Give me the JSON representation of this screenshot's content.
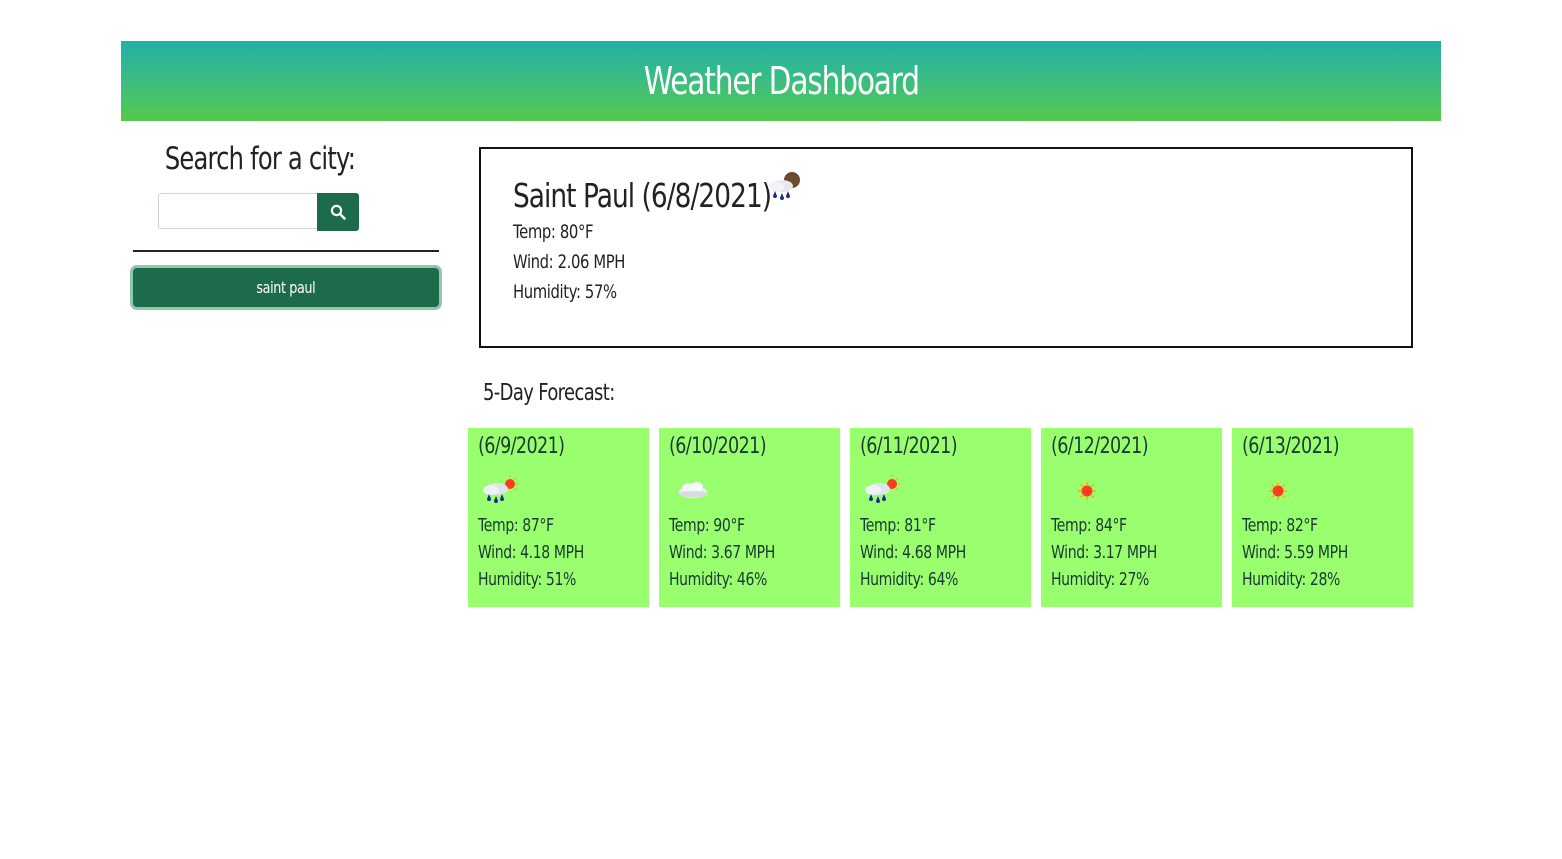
{
  "header": {
    "title": "Weather Dashboard"
  },
  "sidebar": {
    "search_heading": "Search for a city:",
    "search_input_value": "",
    "search_button_icon": "search-icon",
    "history": [
      {
        "label": "saint paul"
      }
    ]
  },
  "current": {
    "title": "Saint Paul (6/8/2021)",
    "icon": "rain-cloud-night-icon",
    "temp": "Temp: 80°F",
    "wind": "Wind: 2.06 MPH",
    "humidity": "Humidity: 57%"
  },
  "forecast": {
    "heading": "5-Day Forecast:",
    "days": [
      {
        "date": "(6/9/2021)",
        "icon": "rain-sun-icon",
        "temp": "Temp: 87°F",
        "wind": "Wind: 4.18 MPH",
        "humidity": "Humidity: 51%"
      },
      {
        "date": "(6/10/2021)",
        "icon": "cloud-icon",
        "temp": "Temp: 90°F",
        "wind": "Wind: 3.67 MPH",
        "humidity": "Humidity: 46%"
      },
      {
        "date": "(6/11/2021)",
        "icon": "rain-sun-icon",
        "temp": "Temp: 81°F",
        "wind": "Wind: 4.68 MPH",
        "humidity": "Humidity: 64%"
      },
      {
        "date": "(6/12/2021)",
        "icon": "sun-icon",
        "temp": "Temp: 84°F",
        "wind": "Wind: 3.17 MPH",
        "humidity": "Humidity: 27%"
      },
      {
        "date": "(6/13/2021)",
        "icon": "sun-icon",
        "temp": "Temp: 82°F",
        "wind": "Wind: 5.59 MPH",
        "humidity": "Humidity: 28%"
      }
    ]
  },
  "colors": {
    "header_gradient_top": "#22b0a8",
    "header_gradient_bottom": "#55c94a",
    "button_green": "#1c6b4a",
    "card_green": "#99ff6e"
  }
}
